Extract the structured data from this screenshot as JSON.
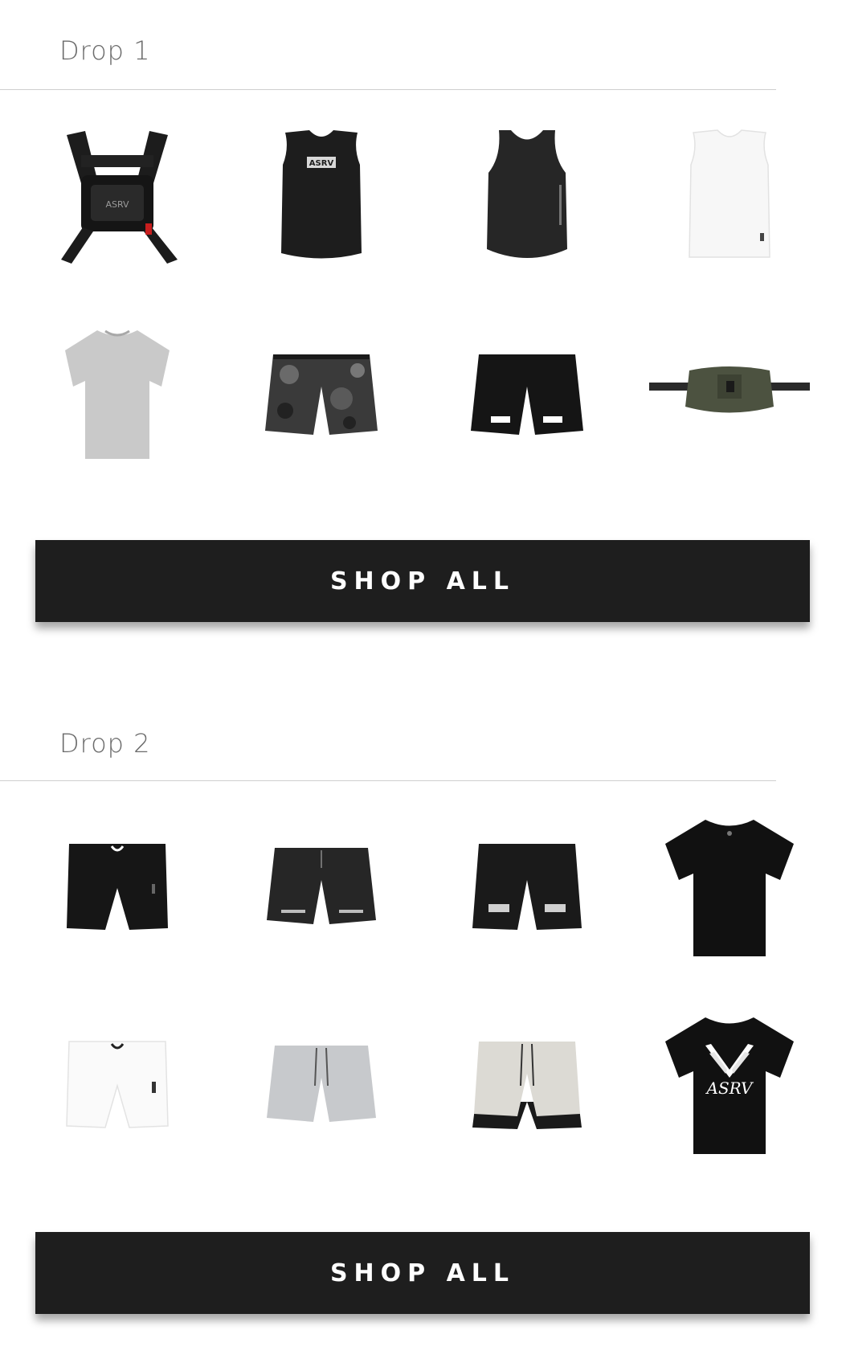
{
  "drops": [
    {
      "title": "Drop 1",
      "cta": "SHOP ALL",
      "products": [
        {
          "icon": "chest-rig-bag-icon",
          "print": "ASRV"
        },
        {
          "icon": "black-muscle-tank-icon",
          "print": "ASRV"
        },
        {
          "icon": "black-tank-top-icon",
          "print": ""
        },
        {
          "icon": "white-muscle-tank-icon",
          "print": ""
        },
        {
          "icon": "grey-tshirt-icon",
          "print": ""
        },
        {
          "icon": "camo-shorts-icon",
          "print": ""
        },
        {
          "icon": "black-running-shorts-icon",
          "print": ""
        },
        {
          "icon": "olive-waist-bag-icon",
          "print": ""
        }
      ]
    },
    {
      "title": "Drop 2",
      "cta": "SHOP ALL",
      "products": [
        {
          "icon": "black-compression-shorts-icon",
          "print": ""
        },
        {
          "icon": "black-training-shorts-icon",
          "print": ""
        },
        {
          "icon": "black-liner-shorts-icon",
          "print": ""
        },
        {
          "icon": "black-tshirt-icon",
          "print": ""
        },
        {
          "icon": "white-compression-shorts-icon",
          "print": ""
        },
        {
          "icon": "grey-sweat-shorts-icon",
          "print": ""
        },
        {
          "icon": "stone-liner-shorts-icon",
          "print": ""
        },
        {
          "icon": "black-graphic-tshirt-icon",
          "print": "ASRV"
        }
      ]
    }
  ],
  "colors": {
    "background": "#ffffff",
    "button": "#1e1e1e",
    "button_text": "#ffffff",
    "title_text": "#6b6b6b",
    "divider": "#cfcfcf"
  }
}
